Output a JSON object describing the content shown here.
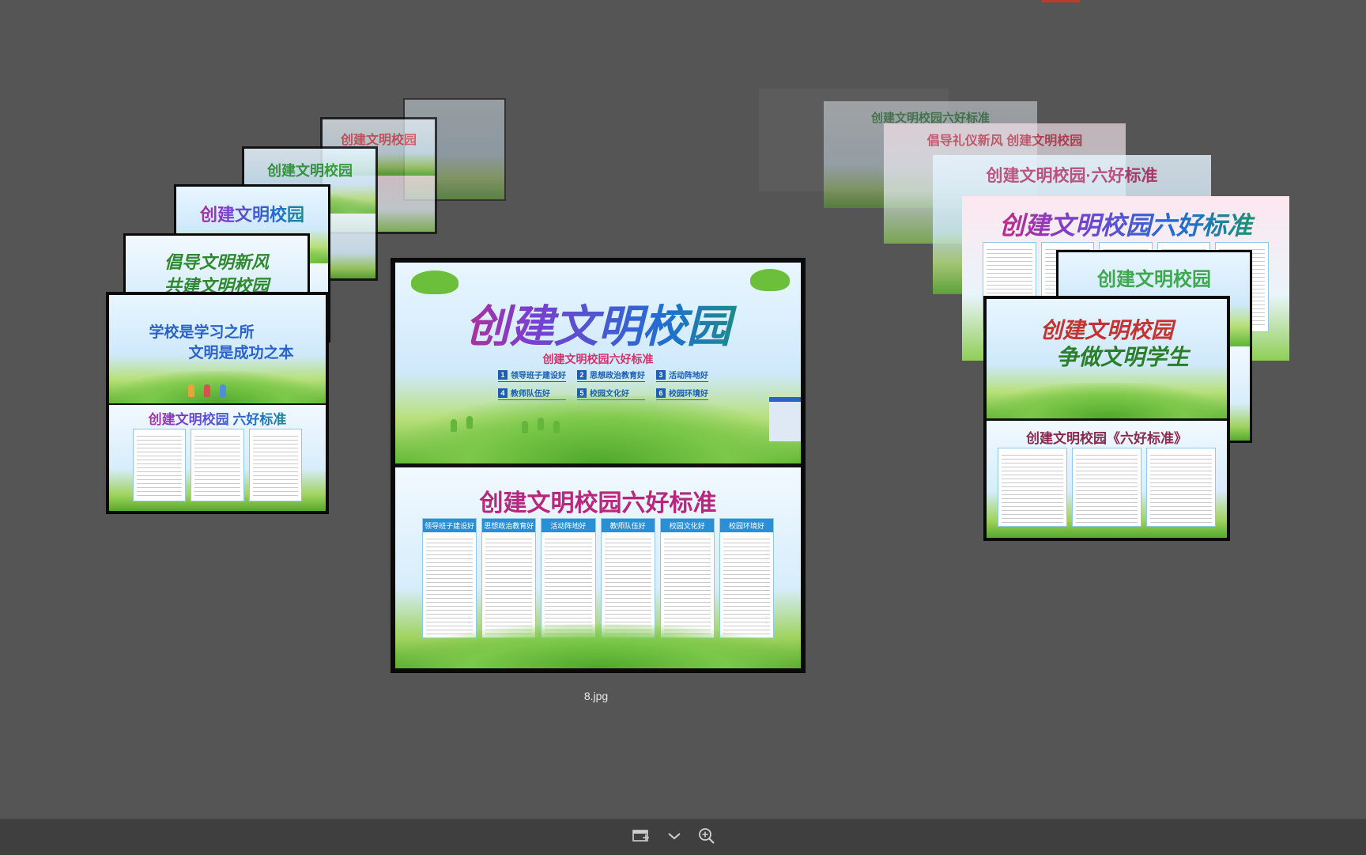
{
  "viewer": {
    "caption": "8.jpg",
    "toolbar": [
      {
        "icon": "slideshow-icon"
      },
      {
        "icon": "chevron-down-icon"
      },
      {
        "icon": "zoom-in-icon"
      }
    ]
  },
  "cards_left": [
    {
      "title": "创建文明校园"
    },
    {
      "title": "创建文明校园"
    },
    {
      "title": "创建文明校园"
    },
    {
      "title": "倡导文明新风",
      "subtitle": "共建文明校园"
    },
    {
      "title": "学校是学习之所",
      "subtitle": "文明是成功之本",
      "bottom_title": "创建文明校园 六好标准"
    }
  ],
  "cards_right": [
    {
      "title": "创建文明校园六好标准"
    },
    {
      "title": "倡导礼仪新风  创建文明校园"
    },
    {
      "title": "创建文明校园·六好标准"
    },
    {
      "title": "创建文明校园六好标准"
    },
    {
      "title": "创建文明校园"
    },
    {
      "title": "创建文明校园",
      "subtitle": "争做文明学生",
      "bottom_title": "创建文明校园《六好标准》"
    }
  ],
  "center_card": {
    "top_title": "创建文明校园",
    "top_subtitle": "创建文明校园六好标准",
    "standards": [
      {
        "num": "1",
        "label": "领导班子建设好"
      },
      {
        "num": "2",
        "label": "思想政治教育好"
      },
      {
        "num": "3",
        "label": "活动阵地好"
      },
      {
        "num": "4",
        "label": "教师队伍好"
      },
      {
        "num": "5",
        "label": "校园文化好"
      },
      {
        "num": "6",
        "label": "校园环境好"
      }
    ],
    "bottom_title": "创建文明校园六好标准",
    "columns": [
      "领导班子建设好",
      "思想政治教育好",
      "活动阵地好",
      "教师队伍好",
      "校园文化好",
      "校园环境好"
    ]
  },
  "colors": {
    "background": "#555555",
    "toolbar": "#3f3f3f",
    "accent": "#1a5fb4"
  }
}
